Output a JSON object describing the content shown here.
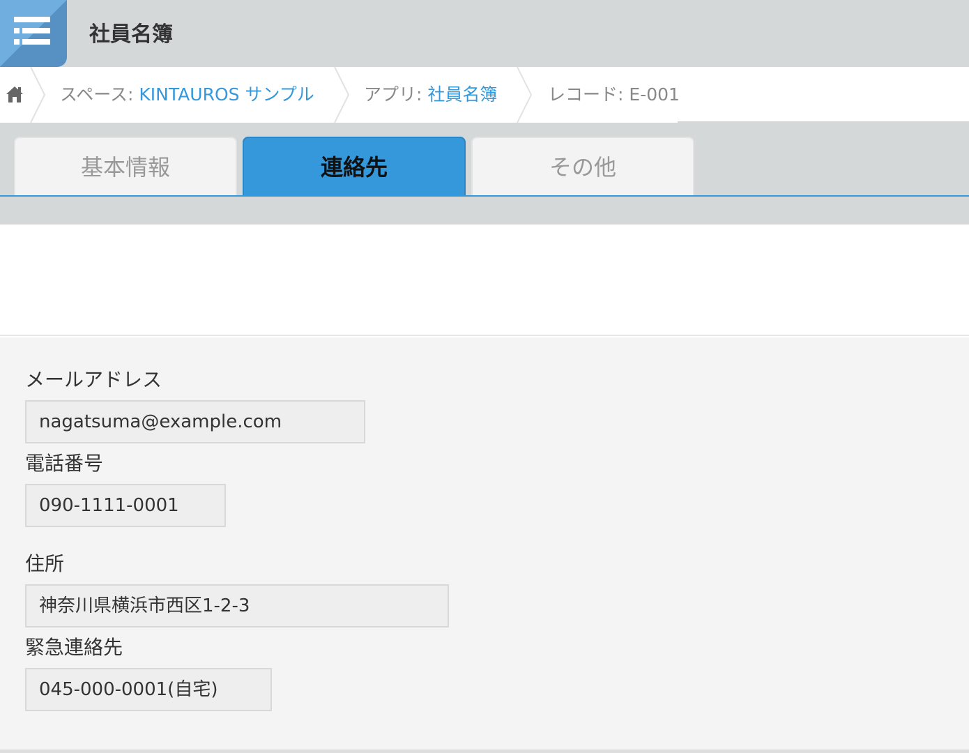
{
  "header": {
    "title": "社員名簿",
    "app_icon": "list-icon",
    "icon_color": "#6faedf"
  },
  "breadcrumb": {
    "home_icon": "home-icon",
    "items": [
      {
        "prefix": "スペース: ",
        "value": "KINTAUROS サンプル"
      },
      {
        "prefix": "アプリ: ",
        "value": "社員名簿"
      },
      {
        "prefix": "レコード: ",
        "value": "E-001"
      }
    ],
    "link_color": "#3498db"
  },
  "tabs": [
    {
      "label": "基本情報",
      "active": false
    },
    {
      "label": "連絡先",
      "active": true
    },
    {
      "label": "その他",
      "active": false
    }
  ],
  "accent_color": "#3498db",
  "fields": [
    {
      "label": "メールアドレス",
      "value": "nagatsuma@example.com"
    },
    {
      "label": "電話番号",
      "value": "090-1111-0001"
    },
    {
      "label": "住所",
      "value": "神奈川県横浜市西区1-2-3"
    },
    {
      "label": "緊急連絡先",
      "value": "045-000-0001(自宅)"
    }
  ]
}
